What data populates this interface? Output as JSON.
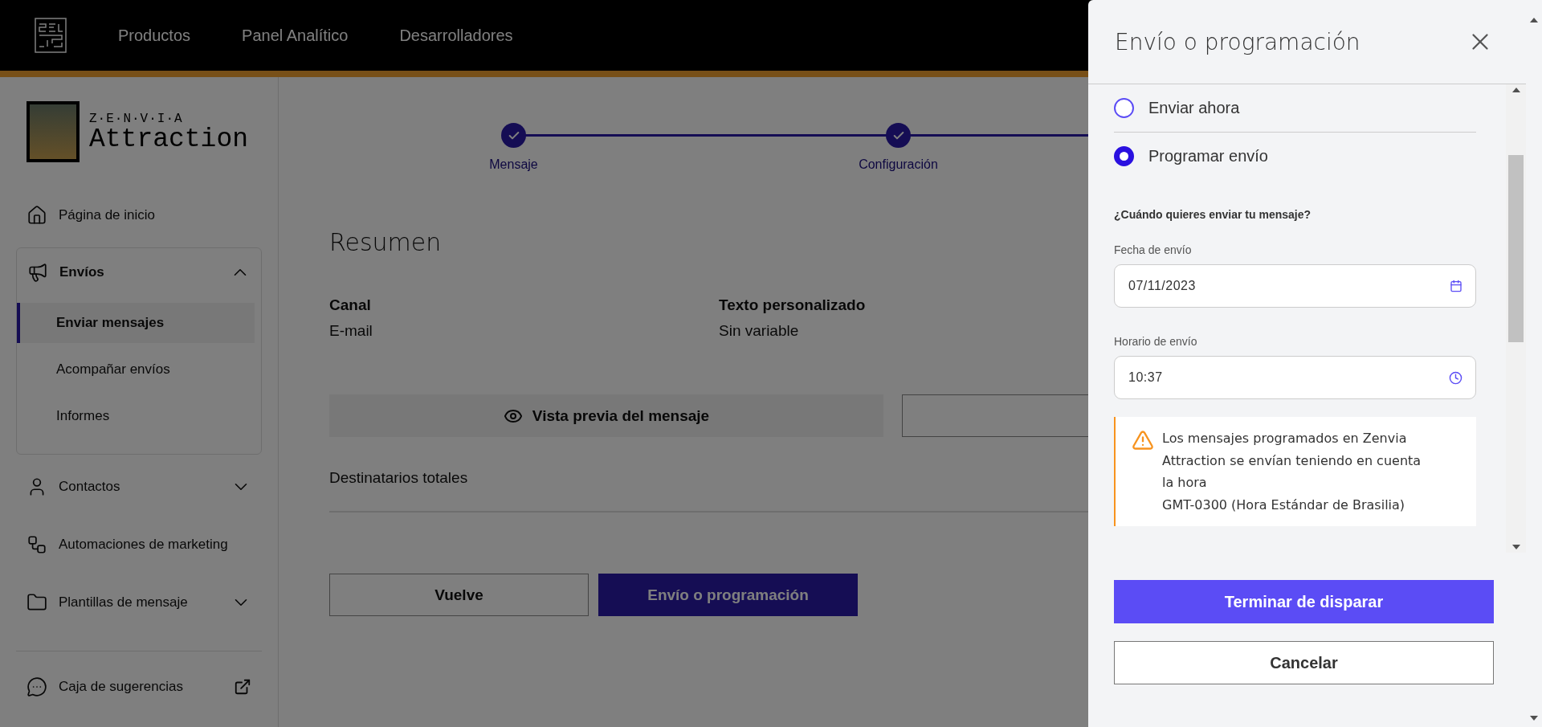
{
  "top_nav": {
    "items": [
      "Productos",
      "Panel Analítico",
      "Desarrolladores"
    ]
  },
  "sidebar": {
    "brand": {
      "tagline": "Z·E·N·V·I·A",
      "name": "Attraction"
    },
    "items": [
      {
        "label": "Página de inicio"
      },
      {
        "label": "Envíos",
        "expanded": true,
        "children": [
          {
            "label": "Enviar mensajes",
            "selected": true
          },
          {
            "label": "Acompañar envíos",
            "selected": false
          },
          {
            "label": "Informes",
            "selected": false
          }
        ]
      },
      {
        "label": "Contactos",
        "expanded": false
      },
      {
        "label": "Automaciones de marketing"
      },
      {
        "label": "Plantillas de mensaje",
        "expanded": false
      }
    ],
    "footer_item": {
      "label": "Caja de sugerencias"
    }
  },
  "stepper": {
    "steps": [
      {
        "label": "Mensaje",
        "done": true
      },
      {
        "label": "Configuración",
        "done": true
      }
    ]
  },
  "summary": {
    "title": "Resumen",
    "fields": [
      {
        "label": "Canal",
        "value": "E-mail"
      },
      {
        "label": "Texto personalizado",
        "value": "Sin variable"
      }
    ],
    "preview_button": "Vista previa del mensaje",
    "recipients_label": "Destinatarios totales",
    "back_button": "Vuelve",
    "submit_button": "Envío o programación"
  },
  "drawer": {
    "title": "Envío o programación",
    "options": [
      {
        "label": "Enviar ahora",
        "selected": false
      },
      {
        "label": "Programar envío",
        "selected": true
      }
    ],
    "question": "¿Cuándo quieres enviar tu mensaje?",
    "date_field": {
      "label": "Fecha de envío",
      "value": "07/11/2023"
    },
    "time_field": {
      "label": "Horario de envío",
      "value": "10:37"
    },
    "notice": {
      "lines": [
        "Los mensajes programados en Zenvia Attraction se envían teniendo en cuenta la hora",
        "GMT-0300 (Hora Estándar de Brasilia)"
      ]
    },
    "confirm_button": "Terminar de disparar",
    "cancel_button": "Cancelar"
  }
}
